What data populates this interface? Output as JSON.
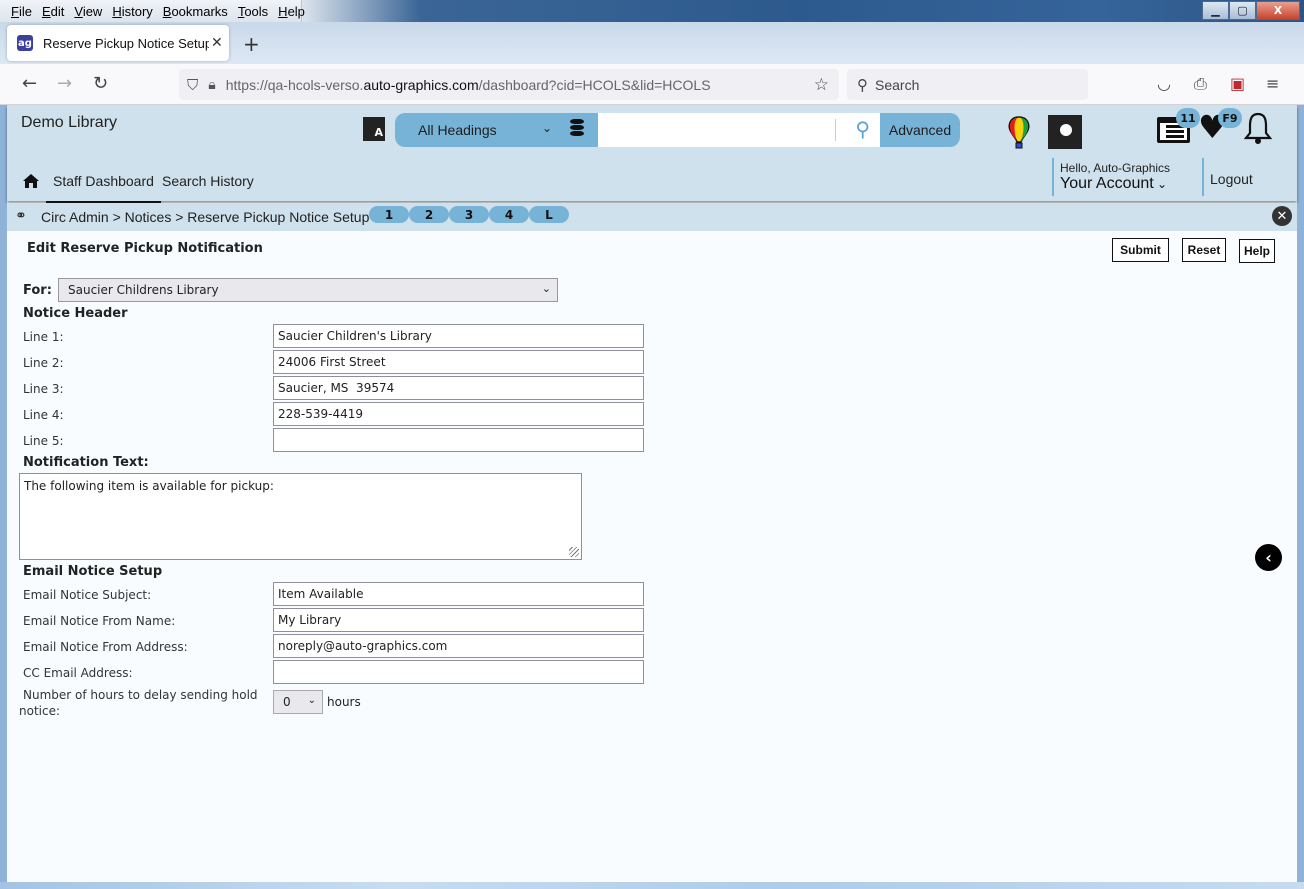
{
  "browser": {
    "menu": [
      "File",
      "Edit",
      "View",
      "History",
      "Bookmarks",
      "Tools",
      "Help"
    ],
    "tab_title": "Reserve Pickup Notice Setup | H",
    "url_prefix": "https://qa-hcols-verso.",
    "url_domain": "auto-graphics.com",
    "url_suffix": "/dashboard?cid=HCOLS&lid=HCOLS",
    "search_placeholder": "Search"
  },
  "header": {
    "library_name": "Demo Library",
    "heading_select": "All Headings",
    "search_value": "",
    "advanced_label": "Advanced",
    "list_badge": "11",
    "favorites_badge": "F9",
    "greeting": "Hello, Auto-Graphics",
    "account_label": "Your Account",
    "logout_label": "Logout"
  },
  "nav": {
    "items": [
      {
        "label": "Staff Dashboard",
        "active": true
      },
      {
        "label": "Search History",
        "active": false
      }
    ]
  },
  "breadcrumb": {
    "text": "Circ Admin > Notices > Reserve Pickup Notice Setup",
    "pills": [
      "1",
      "2",
      "3",
      "4",
      "L"
    ]
  },
  "form": {
    "title": "Edit Reserve Pickup Notification",
    "buttons": {
      "submit": "Submit",
      "reset": "Reset",
      "help": "Help"
    },
    "for_label": "For:",
    "for_value": "Saucier Childrens Library",
    "notice_header_title": "Notice Header",
    "lines": [
      {
        "label": "Line 1:",
        "value": "Saucier Children's Library"
      },
      {
        "label": "Line 2:",
        "value": "24006 First Street"
      },
      {
        "label": "Line 3:",
        "value": "Saucier, MS  39574"
      },
      {
        "label": "Line 4:",
        "value": "228-539-4419"
      },
      {
        "label": "Line 5:",
        "value": ""
      }
    ],
    "notification_text_title": "Notification Text:",
    "notification_text": "The following item is available for pickup:",
    "email_title": "Email Notice Setup",
    "email_fields": [
      {
        "label": "Email Notice Subject:",
        "value": "Item Available"
      },
      {
        "label": "Email Notice From Name:",
        "value": "My Library"
      },
      {
        "label": "Email Notice From Address:",
        "value": "noreply@auto-graphics.com"
      },
      {
        "label": "CC Email Address:",
        "value": ""
      }
    ],
    "delay_label_1": "Number of hours to delay sending hold",
    "delay_label_2": "notice:",
    "delay_value": "0",
    "delay_unit": "hours"
  },
  "colors": {
    "accent": "#77b3d6",
    "header_bg": "#cfe1ec",
    "page_bg": "#f8fcfe"
  }
}
